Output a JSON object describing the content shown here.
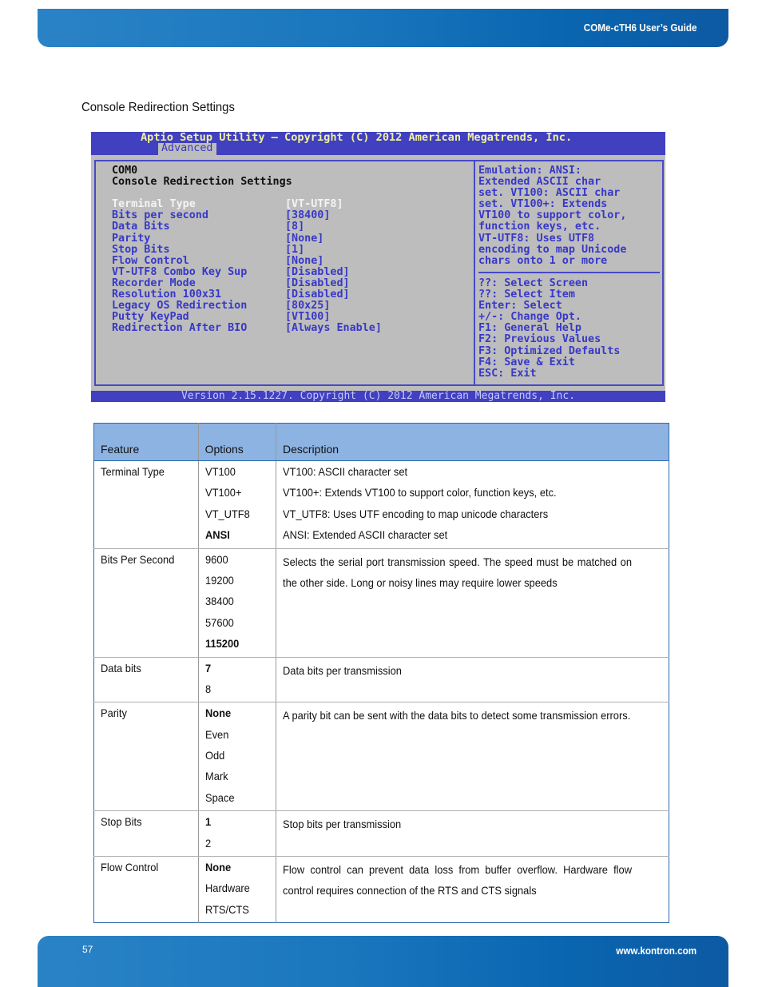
{
  "header": {
    "doc_title": "COMe-cTH6 User’s Guide"
  },
  "section_title": "Console Redirection Settings",
  "bios": {
    "title": "Aptio Setup Utility – Copyright (C) 2012 American Megatrends, Inc.",
    "tab": "Advanced",
    "port": "COM0",
    "heading": "Console Redirection Settings",
    "settings": [
      {
        "label": "Terminal Type",
        "value": "[VT-UTF8]",
        "selected": true
      },
      {
        "label": "Bits per second",
        "value": "[38400]"
      },
      {
        "label": "Data Bits",
        "value": "[8]"
      },
      {
        "label": "Parity",
        "value": "[None]"
      },
      {
        "label": "Stop Bits",
        "value": "[1]"
      },
      {
        "label": "Flow Control",
        "value": "[None]"
      },
      {
        "label": "VT-UTF8 Combo Key Sup",
        "value": "[Disabled]"
      },
      {
        "label": "Recorder Mode",
        "value": "[Disabled]"
      },
      {
        "label": "Resolution 100x31",
        "value": "[Disabled]"
      },
      {
        "label": "Legacy OS Redirection",
        "value": "[80x25]"
      },
      {
        "label": "Putty KeyPad",
        "value": "[VT100]"
      },
      {
        "label": "Redirection After BIO",
        "value": "[Always Enable]"
      }
    ],
    "help_lines": [
      "Emulation: ANSI:",
      "Extended ASCII char",
      "set. VT100: ASCII char",
      "set. VT100+: Extends",
      "VT100 to support color,",
      "function keys, etc.",
      "VT-UTF8: Uses UTF8",
      "encoding to map Unicode",
      "chars onto 1 or more"
    ],
    "key_lines": [
      "??: Select Screen",
      "??: Select Item",
      "Enter: Select",
      "+/-: Change Opt.",
      "F1: General Help",
      "F2: Previous Values",
      "F3: Optimized Defaults",
      "F4: Save & Exit",
      "ESC: Exit"
    ],
    "footer": "Version 2.15.1227. Copyright (C) 2012 American Megatrends, Inc."
  },
  "table": {
    "headers": [
      "Feature",
      "Options",
      "Description"
    ],
    "rows": [
      {
        "feature": "Terminal Type",
        "options": [
          {
            "text": "VT100"
          },
          {
            "text": "VT100+"
          },
          {
            "text": "VT_UTF8"
          },
          {
            "text": "ANSI",
            "default": true
          }
        ],
        "description_lines": [
          "VT100: ASCII character set",
          "VT100+: Extends VT100 to support color, function keys, etc.",
          "VT_UTF8: Uses UTF encoding to map unicode characters",
          "ANSI: Extended ASCII character set"
        ]
      },
      {
        "feature": "Bits Per Second",
        "options": [
          {
            "text": "9600"
          },
          {
            "text": "19200"
          },
          {
            "text": "38400"
          },
          {
            "text": "57600"
          },
          {
            "text": "115200",
            "default": true
          }
        ],
        "description": "Selects the serial port transmission speed.  The speed must be matched on the other side.  Long or noisy lines may require lower speeds"
      },
      {
        "feature": "Data bits",
        "options": [
          {
            "text": "7",
            "default": true
          },
          {
            "text": "8"
          }
        ],
        "description": "Data bits per transmission"
      },
      {
        "feature": "Parity",
        "options": [
          {
            "text": "None",
            "default": true
          },
          {
            "text": "Even"
          },
          {
            "text": "Odd"
          },
          {
            "text": "Mark"
          },
          {
            "text": "Space"
          }
        ],
        "description": "A parity bit can be sent with the data bits to detect some transmission errors."
      },
      {
        "feature": "Stop Bits",
        "options": [
          {
            "text": "1",
            "default": true
          },
          {
            "text": "2"
          }
        ],
        "description": "Stop bits per transmission"
      },
      {
        "feature": "Flow Control",
        "options": [
          {
            "text": "None",
            "default": true
          },
          {
            "text": "Hardware"
          },
          {
            "text": "RTS/CTS"
          }
        ],
        "description": "Flow control can prevent data loss from buffer overflow.  Hardware flow control requires connection of the RTS and CTS signals"
      }
    ]
  },
  "footer": {
    "page_number": "57",
    "website": "www.kontron.com"
  }
}
